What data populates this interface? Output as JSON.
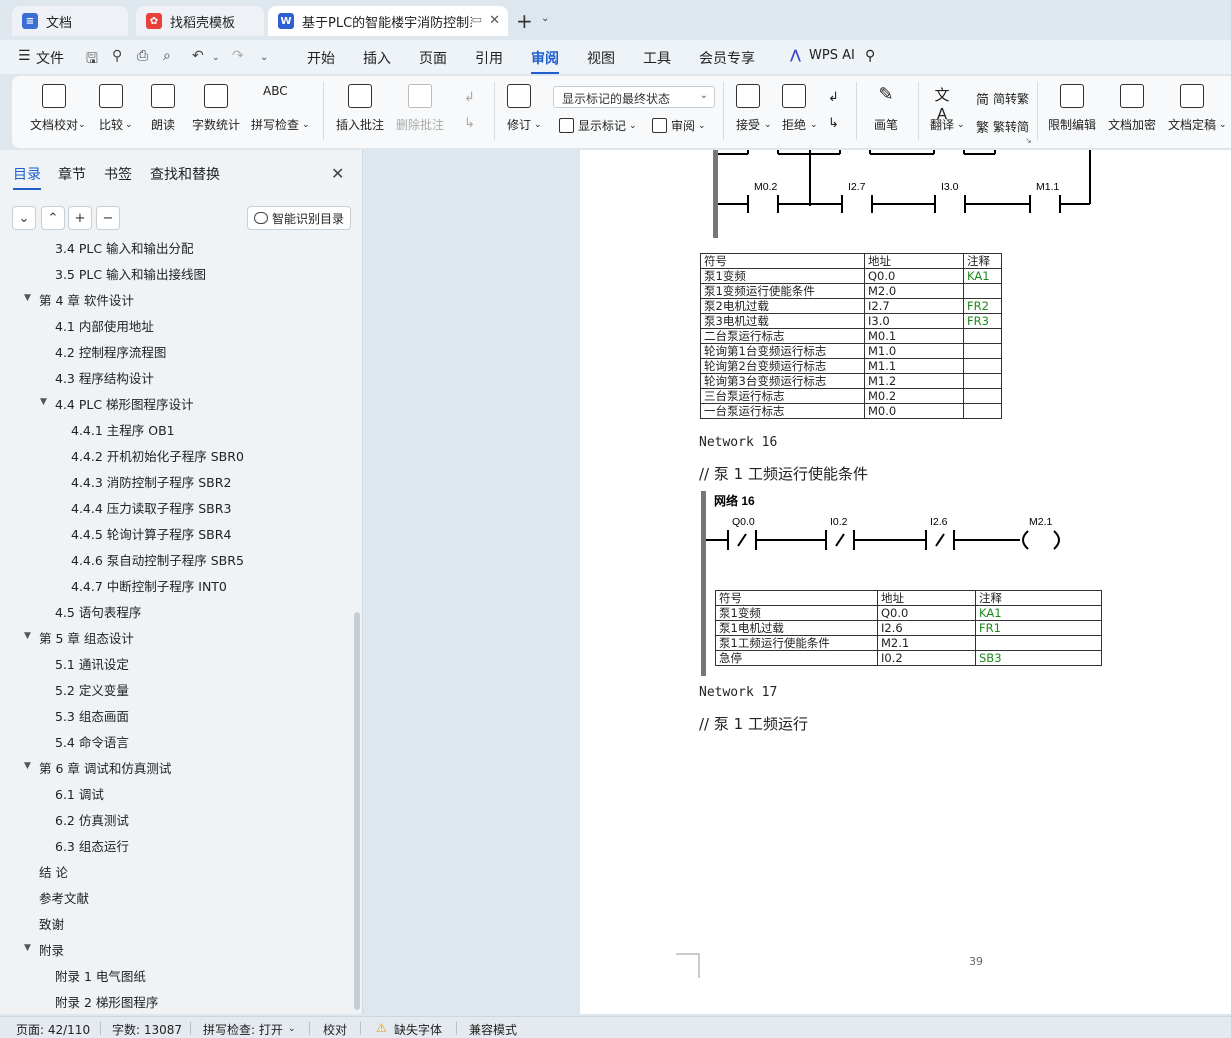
{
  "tabs": [
    {
      "label": "文档",
      "icon": "doc-icon",
      "color": "#3b6fd6",
      "active": false
    },
    {
      "label": "找稻壳模板",
      "icon": "docer-icon",
      "color": "#e8413a",
      "active": false
    },
    {
      "label": "基于PLC的智能楼宇消防控制系",
      "icon": "word-icon",
      "color": "#2f5fd3",
      "active": true
    }
  ],
  "menu": {
    "file": "文件",
    "items": [
      "开始",
      "插入",
      "页面",
      "引用",
      "审阅",
      "视图",
      "工具",
      "会员专享"
    ],
    "active": "审阅",
    "wps_ai": "WPS AI"
  },
  "ribbon": {
    "doc_check": "文档校对",
    "compare": "比较",
    "read_aloud": "朗读",
    "word_count": "字数统计",
    "spell_check": "拼写检查",
    "insert_comment": "插入批注",
    "delete_comment": "删除批注",
    "revise": "修订",
    "markup_select": "显示标记的最终状态",
    "show_markup": "显示标记",
    "review": "审阅",
    "accept": "接受",
    "reject": "拒绝",
    "pen": "画笔",
    "translate": "翻译",
    "to_traditional": "简转繁",
    "to_simplified": "繁转简",
    "restrict_edit": "限制编辑",
    "encrypt": "文档加密",
    "finalize": "文档定稿"
  },
  "leftpane": {
    "tabs": [
      "目录",
      "章节",
      "书签",
      "查找和替换"
    ],
    "active_tab": "目录",
    "smart_toc": "智能识别目录",
    "toc": [
      {
        "text": "3.4   PLC 输入和输出分配",
        "level": 2
      },
      {
        "text": "3.5   PLC 输入和输出接线图",
        "level": 2
      },
      {
        "text": "第 4 章   软件设计",
        "level": 1,
        "expanded": true
      },
      {
        "text": "4.1   内部使用地址",
        "level": 2
      },
      {
        "text": "4.2   控制程序流程图",
        "level": 2
      },
      {
        "text": "4.3   程序结构设计",
        "level": 2
      },
      {
        "text": "4.4   PLC 梯形图程序设计",
        "level": 2,
        "expanded": true
      },
      {
        "text": "4.4.1  主程序 OB1",
        "level": 3
      },
      {
        "text": "4.4.2  开机初始化子程序 SBR0",
        "level": 3
      },
      {
        "text": "4.4.3  消防控制子程序 SBR2",
        "level": 3
      },
      {
        "text": "4.4.4  压力读取子程序 SBR3",
        "level": 3
      },
      {
        "text": "4.4.5  轮询计算子程序 SBR4",
        "level": 3
      },
      {
        "text": "4.4.6    泵自动控制子程序 SBR5",
        "level": 3
      },
      {
        "text": "4.4.7    中断控制子程序 INT0",
        "level": 3
      },
      {
        "text": "4.5   语句表程序",
        "level": 2
      },
      {
        "text": "第 5 章  组态设计",
        "level": 1,
        "expanded": true
      },
      {
        "text": "5.1   通讯设定",
        "level": 2
      },
      {
        "text": "5.2   定义变量",
        "level": 2
      },
      {
        "text": "5.3   组态画面",
        "level": 2
      },
      {
        "text": "5.4   命令语言",
        "level": 2
      },
      {
        "text": "第 6 章   调试和仿真测试",
        "level": 1,
        "expanded": true
      },
      {
        "text": "6.1   调试",
        "level": 2
      },
      {
        "text": "6.2   仿真测试",
        "level": 2
      },
      {
        "text": "6.3   组态运行",
        "level": 2
      },
      {
        "text": "结   论",
        "level": 1
      },
      {
        "text": "参考文献",
        "level": 1
      },
      {
        "text": "致谢",
        "level": 1
      },
      {
        "text": "附录",
        "level": 1,
        "expanded": true
      },
      {
        "text": "附录 1    电气图纸",
        "level": 2
      },
      {
        "text": "附录 2    梯形图程序",
        "level": 2
      }
    ]
  },
  "document": {
    "top_contacts": [
      "M0.2",
      "I2.7",
      "I3.0",
      "M1.1"
    ],
    "table1": {
      "headers": [
        "符号",
        "地址",
        "注释"
      ],
      "rows": [
        [
          "泵1变频",
          "Q0.0",
          "KA1"
        ],
        [
          "泵1变频运行使能条件",
          "M2.0",
          ""
        ],
        [
          "泵2电机过载",
          "I2.7",
          "FR2"
        ],
        [
          "泵3电机过载",
          "I3.0",
          "FR3"
        ],
        [
          "二台泵运行标志",
          "M0.1",
          ""
        ],
        [
          "轮询第1台变频运行标志",
          "M1.0",
          ""
        ],
        [
          "轮询第2台变频运行标志",
          "M1.1",
          ""
        ],
        [
          "轮询第3台变频运行标志",
          "M1.2",
          ""
        ],
        [
          "三台泵运行标志",
          "M0.2",
          ""
        ],
        [
          "一台泵运行标志",
          "M0.0",
          ""
        ]
      ]
    },
    "network16_label": "Network  16",
    "network16_comment": "//  泵 1 工频运行使能条件",
    "network16_title": "网络  16",
    "network16_contacts": [
      "Q0.0",
      "I0.2",
      "I2.6"
    ],
    "network16_contact_glyph": "/",
    "network16_coil": "M2.1",
    "table2": {
      "headers": [
        "符号",
        "地址",
        "注释"
      ],
      "rows": [
        [
          "泵1变频",
          "Q0.0",
          "KA1"
        ],
        [
          "泵1电机过载",
          "I2.6",
          "FR1"
        ],
        [
          "泵1工频运行使能条件",
          "M2.1",
          ""
        ],
        [
          "急停",
          "I0.2",
          "SB3"
        ]
      ]
    },
    "network17_label": "Network  17",
    "network17_comment": "//  泵 1 工频运行",
    "page_number": "39"
  },
  "status": {
    "page": "页面: 42/110",
    "words": "字数: 13087",
    "spell": "拼写检查: 打开",
    "proof": "校对",
    "missing_font": "缺失字体",
    "compat": "兼容模式"
  }
}
